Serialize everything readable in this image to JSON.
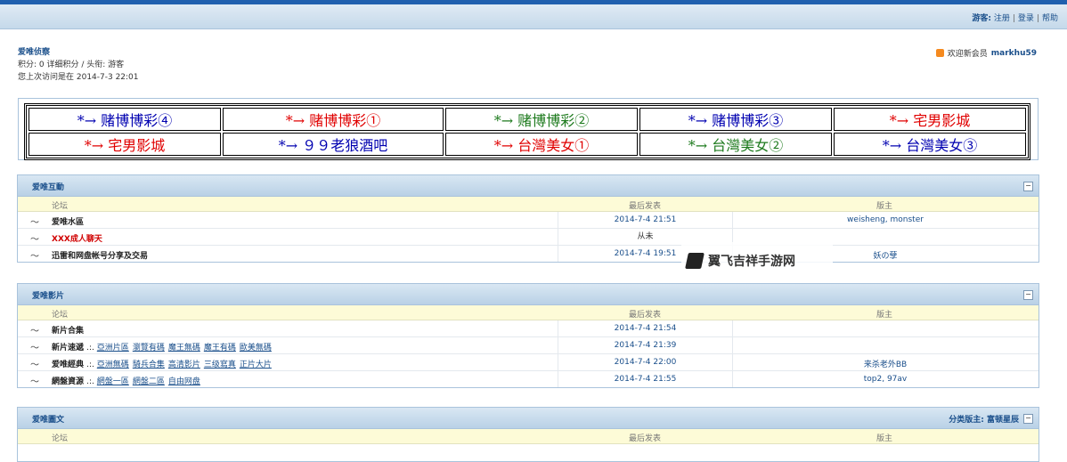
{
  "userbar": {
    "guest_label": "游客:",
    "register": "注册",
    "login": "登录",
    "help": "帮助",
    "separator": "|"
  },
  "profile": {
    "name": "爱唯侦察",
    "points_line": "积分: 0 详细积分 / 头衔: 游客",
    "last_visit": "您上次访问是在 2014-7-3 22:01"
  },
  "welcome": {
    "text": "欢迎新会员",
    "member": "markhu59"
  },
  "ads": [
    [
      {
        "text": "*→ 赌博博彩④",
        "color": "#0000b0"
      },
      {
        "text": "*→ 赌博博彩①",
        "color": "#e00000"
      },
      {
        "text": "*→ 赌博博彩②",
        "color": "#1d7a1d"
      },
      {
        "text": "*→ 赌博博彩③",
        "color": "#0000b0"
      },
      {
        "text": "*→ 宅男影城",
        "color": "#e00000"
      }
    ],
    [
      {
        "text": "*→ 宅男影城",
        "color": "#e00000"
      },
      {
        "text": "*→ ９９老狼酒吧",
        "color": "#0000b0"
      },
      {
        "text": "*→ 台灣美女①",
        "color": "#e00000"
      },
      {
        "text": "*→ 台灣美女②",
        "color": "#1d7a1d"
      },
      {
        "text": "*→ 台灣美女③",
        "color": "#0000b0"
      }
    ]
  ],
  "columns": {
    "forum": "论坛",
    "last_post": "最后发表",
    "moderator": "版主"
  },
  "sections": [
    {
      "title": "爱唯互動",
      "mods": "",
      "rows": [
        {
          "icon": "〜",
          "name": "爱唯水區",
          "red": false,
          "subs_prefix": "",
          "subs": [],
          "last": "2014-7-4 21:51",
          "mod": "weisheng, monster"
        },
        {
          "icon": "〜",
          "name": "XXX成人聊天",
          "red": true,
          "subs_prefix": "",
          "subs": [],
          "last": "从未",
          "mod": ""
        },
        {
          "icon": "〜",
          "name": "迅雷和网盘帐号分享及交易",
          "red": false,
          "subs_prefix": "",
          "subs": [],
          "last": "2014-7-4 19:51",
          "mod": "妖の孽"
        }
      ]
    },
    {
      "title": "爱唯影片",
      "mods": "",
      "rows": [
        {
          "icon": "〜",
          "name": "新片合集",
          "red": false,
          "subs_prefix": "",
          "subs": [],
          "last": "2014-7-4 21:54",
          "mod": ""
        },
        {
          "icon": "〜",
          "name": "新片速遞",
          "red": false,
          "subs_prefix": ".:.",
          "subs": [
            "亞洲片區",
            "瀏覽有碼",
            "魔王無碼",
            "魔王有碼",
            "歐美無碼"
          ],
          "last": "2014-7-4 21:39",
          "mod": ""
        },
        {
          "icon": "〜",
          "name": "爱唯經典",
          "red": false,
          "subs_prefix": ".:.",
          "subs": [
            "亞洲無碼",
            "騎兵合集",
            "高清影片",
            "三级寫真",
            "正片大片"
          ],
          "last": "2014-7-4 22:00",
          "mod": "来杀老外BB"
        },
        {
          "icon": "〜",
          "name": "網盤資源",
          "red": false,
          "subs_prefix": ".:.",
          "subs": [
            "網盤一區",
            "網盤二區",
            "自由网盘"
          ],
          "last": "2014-7-4 21:55",
          "mod": "top2, 97av"
        }
      ]
    },
    {
      "title": "爱唯圖文",
      "mods": "分类版主: 富顿星辰",
      "rows": []
    }
  ],
  "watermark": {
    "text": "翼飞吉祥手游网"
  },
  "icons": {
    "rss": "rss-icon",
    "collapse": "collapse-icon",
    "forum": "forum-status-icon"
  }
}
